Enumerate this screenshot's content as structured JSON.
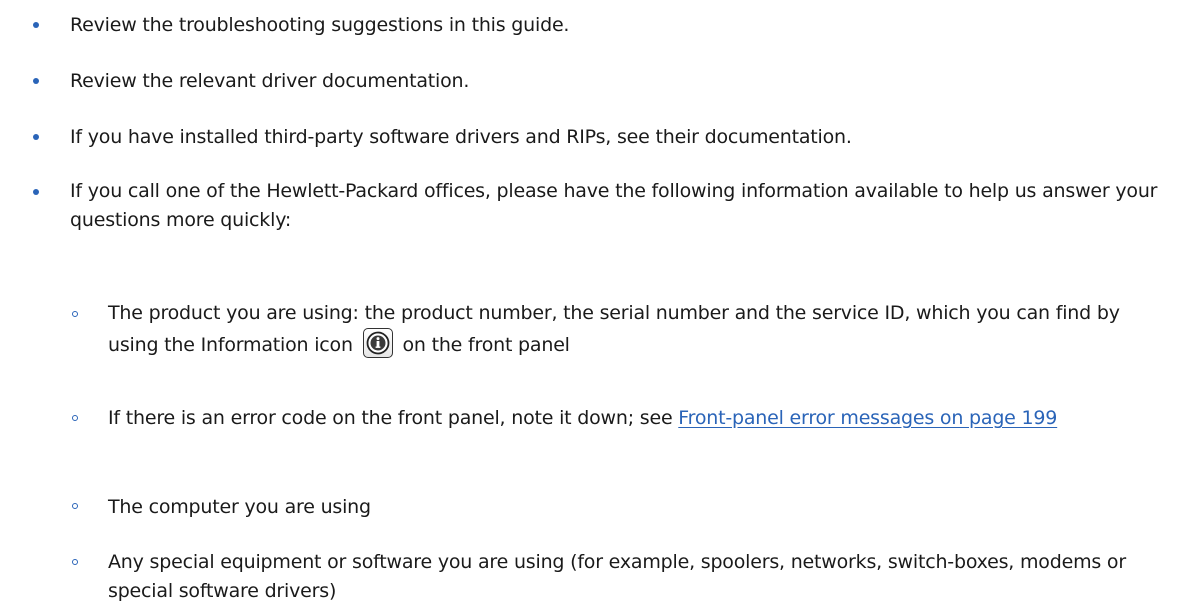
{
  "items": [
    {
      "text": "Review the troubleshooting suggestions in this guide."
    },
    {
      "text": "Review the relevant driver documentation."
    },
    {
      "text": "If you have installed third-party software drivers and RIPs, see their documentation."
    },
    {
      "text": "If you call one of the Hewlett-Packard offices, please have the following information available to help us answer your questions more quickly:"
    }
  ],
  "subitems": {
    "product": {
      "text_before": "The product you are using: the product number, the serial number and the service ID, which you can find by using the Information icon",
      "icon": "information-icon",
      "text_after": "on the front panel"
    },
    "error_code": {
      "text_before": "If there is an error code on the front panel, note it down; see",
      "link_text": "Front-panel error messages on page 199"
    },
    "computer": {
      "text": "The computer you are using"
    },
    "equipment": {
      "text": "Any special equipment or software you are using (for example, spoolers, networks, switch-boxes, modems or special software drivers)"
    }
  },
  "colors": {
    "bullet": "#2a64b8",
    "link": "#2a64b8",
    "text": "#1a1a1a"
  }
}
